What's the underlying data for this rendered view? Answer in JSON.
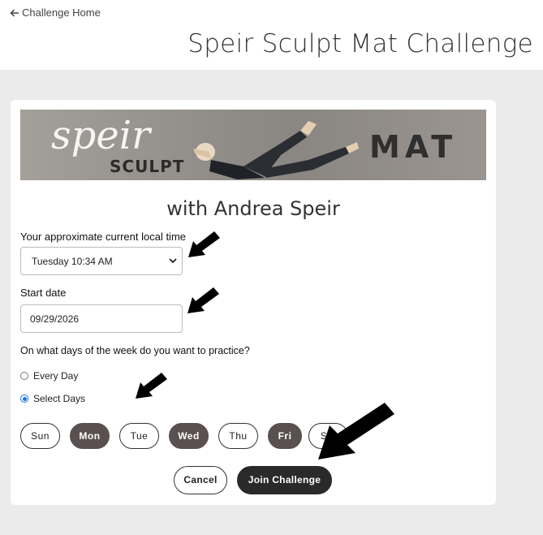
{
  "header": {
    "back_label": "Challenge Home",
    "page_title": "Speir Sculpt Mat Challenge"
  },
  "banner": {
    "logo_script": "speir",
    "logo_sub": "SCULPT",
    "program": "MAT"
  },
  "card": {
    "subtitle": "with Andrea Speir",
    "time_label": "Your approximate current local time",
    "time_value": "Tuesday 10:34 AM",
    "start_label": "Start date",
    "start_value": "09/29/2026",
    "days_question": "On what days of the week do you want to practice?",
    "radio_every": "Every Day",
    "radio_select": "Select Days",
    "selected_mode": "Select Days",
    "days": [
      {
        "label": "Sun",
        "selected": false
      },
      {
        "label": "Mon",
        "selected": true
      },
      {
        "label": "Tue",
        "selected": false
      },
      {
        "label": "Wed",
        "selected": true
      },
      {
        "label": "Thu",
        "selected": false
      },
      {
        "label": "Fri",
        "selected": true
      },
      {
        "label": "Sat",
        "selected": false
      }
    ],
    "cancel_label": "Cancel",
    "join_label": "Join Challenge"
  },
  "colors": {
    "selected_day": "#5a5050",
    "join_button": "#2a2a2a",
    "radio_accent": "#1a73e8",
    "background": "#ebebeb"
  }
}
